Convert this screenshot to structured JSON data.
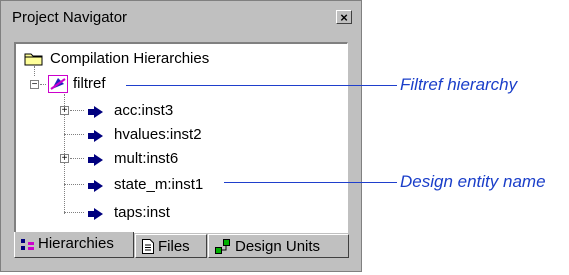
{
  "window": {
    "title": "Project Navigator",
    "close_label": "×"
  },
  "tree": {
    "root": {
      "label": "Compilation Hierarchies",
      "icon": "folder-icon"
    },
    "top": {
      "label": "filtref",
      "icon": "top-entity-icon",
      "expanded": true
    },
    "children": [
      {
        "label": "acc:inst3",
        "expandable": true
      },
      {
        "label": "hvalues:inst2",
        "expandable": false
      },
      {
        "label": "mult:inst6",
        "expandable": true
      },
      {
        "label": "state_m:inst1",
        "expandable": false
      },
      {
        "label": "taps:inst",
        "expandable": false
      }
    ]
  },
  "tabs": [
    {
      "label": "Hierarchies",
      "icon": "hierarchy-icon",
      "active": true
    },
    {
      "label": "Files",
      "icon": "file-icon",
      "active": false
    },
    {
      "label": "Design Units",
      "icon": "design-units-icon",
      "active": false
    }
  ],
  "callouts": [
    {
      "label": "Filtref hierarchy"
    },
    {
      "label": "Design entity name"
    }
  ],
  "colors": {
    "callout": "#1a3ec9",
    "arrow_icon": "#00007f",
    "top_icon_accent": "#cc00cc"
  }
}
